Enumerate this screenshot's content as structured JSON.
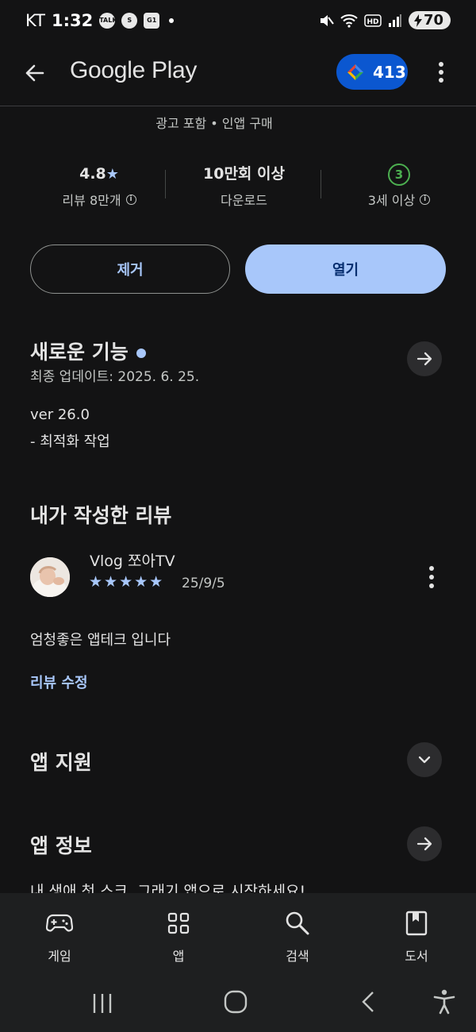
{
  "status_bar": {
    "carrier": "KT",
    "time": "1:32",
    "notif_icons": [
      "talk-icon",
      "swirl-icon",
      "g1-icon"
    ],
    "battery": "70"
  },
  "app_bar": {
    "title": "Google Play",
    "points": "413"
  },
  "app_meta": "광고 포함 • 인앱 구매",
  "stats": {
    "rating_value": "4.8",
    "rating_label": "리뷰 8만개",
    "downloads_value": "10만회 이상",
    "downloads_label": "다운로드",
    "age_value": "3",
    "age_label": "3세 이상"
  },
  "actions": {
    "uninstall": "제거",
    "open": "열기"
  },
  "whats_new": {
    "title": "새로운 기능",
    "updated": "최종 업데이트: 2025. 6. 25.",
    "version": "ver 26.0",
    "note": "- 최적화 작업"
  },
  "my_review": {
    "title": "내가 작성한 리뷰",
    "reviewer": "Vlog 쪼아TV",
    "stars": "★★★★★",
    "date": "25/9/5",
    "text": "엄청좋은 앱테크 입니다",
    "edit_link": "리뷰 수정"
  },
  "app_support": {
    "title": "앱 지원"
  },
  "about": {
    "title": "앱 정보",
    "clipped": "내 생애 첫 스크, 그래기 앱으로 시작하세요!"
  },
  "bottom_nav": [
    {
      "label": "게임",
      "icon": "gamepad-icon"
    },
    {
      "label": "앱",
      "icon": "apps-grid-icon"
    },
    {
      "label": "검색",
      "icon": "search-icon"
    },
    {
      "label": "도서",
      "icon": "book-icon"
    }
  ],
  "colors": {
    "background": "#131314",
    "accent": "#a8c7fa",
    "points_pill": "#0b57d0",
    "age_green": "#4caf50"
  }
}
